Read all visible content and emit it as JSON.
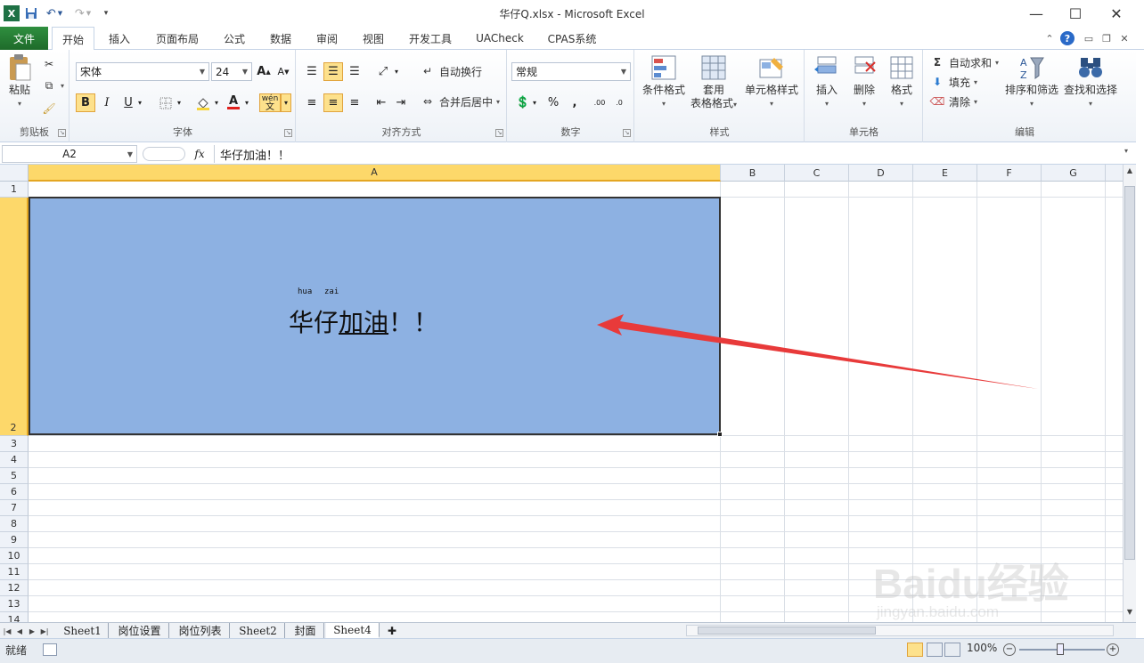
{
  "window": {
    "title": "华仔Q.xlsx  -  Microsoft Excel",
    "minimize": "—",
    "maximize": "☐",
    "close": "✕"
  },
  "qat": {
    "excel_icon": "X",
    "undo_glyph": "↶",
    "redo_glyph": "↷"
  },
  "menu": {
    "file": "文件",
    "tabs": [
      {
        "label": "开始"
      },
      {
        "label": "插入"
      },
      {
        "label": "页面布局"
      },
      {
        "label": "公式"
      },
      {
        "label": "数据"
      },
      {
        "label": "审阅"
      },
      {
        "label": "视图"
      },
      {
        "label": "开发工具"
      },
      {
        "label": "UACheck"
      },
      {
        "label": "CPAS系统"
      }
    ],
    "help_glyph": "?"
  },
  "ribbon": {
    "clipboard": {
      "label": "剪贴板",
      "paste": "粘贴"
    },
    "font": {
      "label": "字体",
      "font_name": "宋体",
      "font_size": "24",
      "grow": "A",
      "shrink": "A",
      "bold": "B",
      "italic": "I",
      "underline": "U",
      "font_color_glyph": "A",
      "phonetic": "wén"
    },
    "alignment": {
      "label": "对齐方式",
      "wrap": "自动换行",
      "merge": "合并后居中"
    },
    "number": {
      "label": "数字",
      "format": "常规",
      "percent": "%",
      "comma": ",",
      "inc_decimal": ".00",
      "dec_decimal": ".0"
    },
    "styles": {
      "label": "样式",
      "conditional": "条件格式",
      "table_line1": "套用",
      "table_line2": "表格格式",
      "cell_styles": "单元格样式"
    },
    "cells": {
      "label": "单元格",
      "insert": "插入",
      "delete": "删除",
      "format": "格式"
    },
    "editing": {
      "label": "编辑",
      "autosum": "自动求和",
      "fill": "填充",
      "clear": "清除",
      "sort": "排序和筛选",
      "find": "查找和选择",
      "sigma": "Σ"
    }
  },
  "formula_bar": {
    "name_box": "A2",
    "fx": "fx",
    "value": "华仔加油！！"
  },
  "grid": {
    "columns": [
      "A",
      "B",
      "C",
      "D",
      "E",
      "F",
      "G"
    ],
    "selected_column": "A",
    "rows": [
      "1",
      "2",
      "3",
      "4",
      "5",
      "6",
      "7",
      "8",
      "9",
      "10",
      "11",
      "12",
      "13",
      "14"
    ],
    "selected_row": "2",
    "cell": {
      "ruby1": "hua",
      "ruby2": "zai",
      "text_plain": "华仔",
      "text_underlined": "加油",
      "text_tail": "！！"
    },
    "cell_fill": "#8db1e2",
    "arrow_color": "#e83a3a"
  },
  "sheets": {
    "tabs": [
      {
        "label": "Sheet1"
      },
      {
        "label": "岗位设置"
      },
      {
        "label": "岗位列表"
      },
      {
        "label": "Sheet2"
      },
      {
        "label": "封面"
      },
      {
        "label": "Sheet4"
      }
    ],
    "active": "Sheet4"
  },
  "status": {
    "ready": "就绪",
    "zoom": "100%"
  },
  "watermark": {
    "brand": "Baidu经验",
    "url": "jingyan.baidu.com"
  }
}
